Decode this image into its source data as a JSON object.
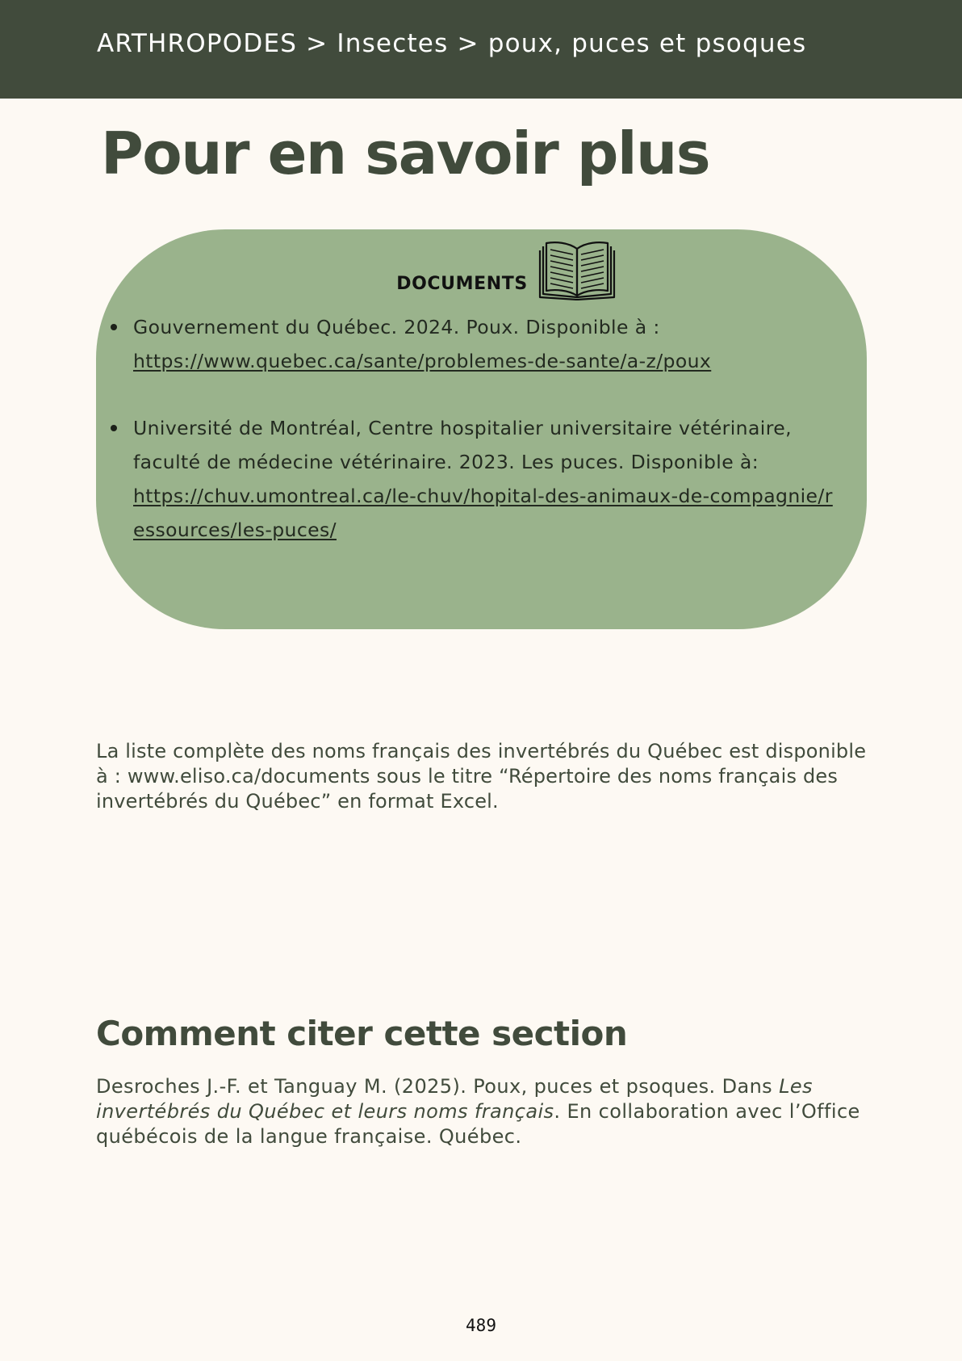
{
  "header": {
    "breadcrumb": "ARTHROPODES > Insectes > poux, puces et psoques"
  },
  "page_title": "Pour en savoir plus",
  "documents": {
    "heading": "DOCUMENTS",
    "icon": "open-book-icon",
    "items": [
      {
        "text": "Gouvernement du Québec. 2024. Poux. Disponible à :",
        "link": "https://www.quebec.ca/sante/problemes-de-sante/a-z/poux"
      },
      {
        "text": "Université de Montréal, Centre hospitalier universitaire vétérinaire, faculté de médecine vétérinaire. 2023. Les puces. Disponible à:",
        "link": "https://chuv.umontreal.ca/le-chuv/hopital-des-animaux-de-compagnie/ressources/les-puces/"
      }
    ]
  },
  "intro_note": "La liste complète des noms français des invertébrés du Québec est disponible à : www.eliso.ca/documents sous le titre “Répertoire des noms français des invertébrés du Québec” en format Excel.",
  "citation_section": {
    "title": "Comment citer cette section",
    "text_before": "Desroches J.-F. et Tanguay M. (2025). Poux, puces et psoques. Dans ",
    "text_italic": "Les invertébrés du Québec et leurs noms français",
    "text_after": ". En collaboration avec l’Office québécois de la langue française. Québec."
  },
  "page_number": "489",
  "colors": {
    "header_band": "#414b3c",
    "documents_box": "#9ab38c",
    "page_background": "#fdf9f3",
    "title_text": "#414b3c"
  }
}
